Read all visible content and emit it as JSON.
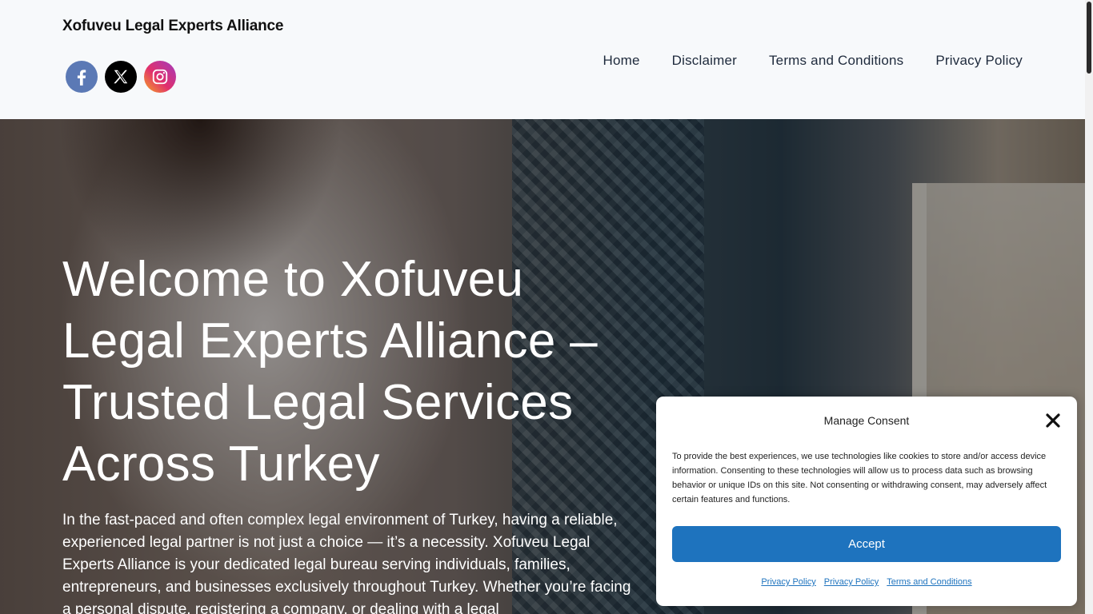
{
  "site": {
    "title": "Xofuveu Legal Experts Alliance"
  },
  "social": [
    {
      "name": "Facebook",
      "icon": "facebook-icon"
    },
    {
      "name": "X",
      "icon": "x-icon"
    },
    {
      "name": "Instagram",
      "icon": "instagram-icon"
    }
  ],
  "nav": {
    "items": [
      "Home",
      "Disclaimer",
      "Terms and Conditions",
      "Privacy Policy"
    ]
  },
  "hero": {
    "title": "Welcome to Xofuveu Legal Experts Alliance – Trusted Legal Services Across Turkey",
    "text": "In the fast-paced and often complex legal environment of Turkey, having a reliable, experienced legal partner is not just a choice — it’s a necessity. Xofuveu Legal Experts Alliance is your dedicated legal bureau serving individuals, families, entrepreneurs, and businesses exclusively throughout Turkey. Whether you’re facing a personal dispute, registering a company, or dealing with a legal"
  },
  "consent": {
    "title": "Manage Consent",
    "text": "To provide the best experiences, we use technologies like cookies to store and/or access device information. Consenting to these technologies will allow us to process data such as browsing behavior or unique IDs on this site. Not consenting or withdrawing consent, may adversely affect certain features and functions.",
    "accept_label": "Accept",
    "links": [
      "Privacy Policy",
      "Privacy Policy",
      "Terms and Conditions"
    ]
  },
  "colors": {
    "accent": "#1e73be",
    "header_bg": "#f7f9fb",
    "nav_text": "#1e2a3c"
  }
}
